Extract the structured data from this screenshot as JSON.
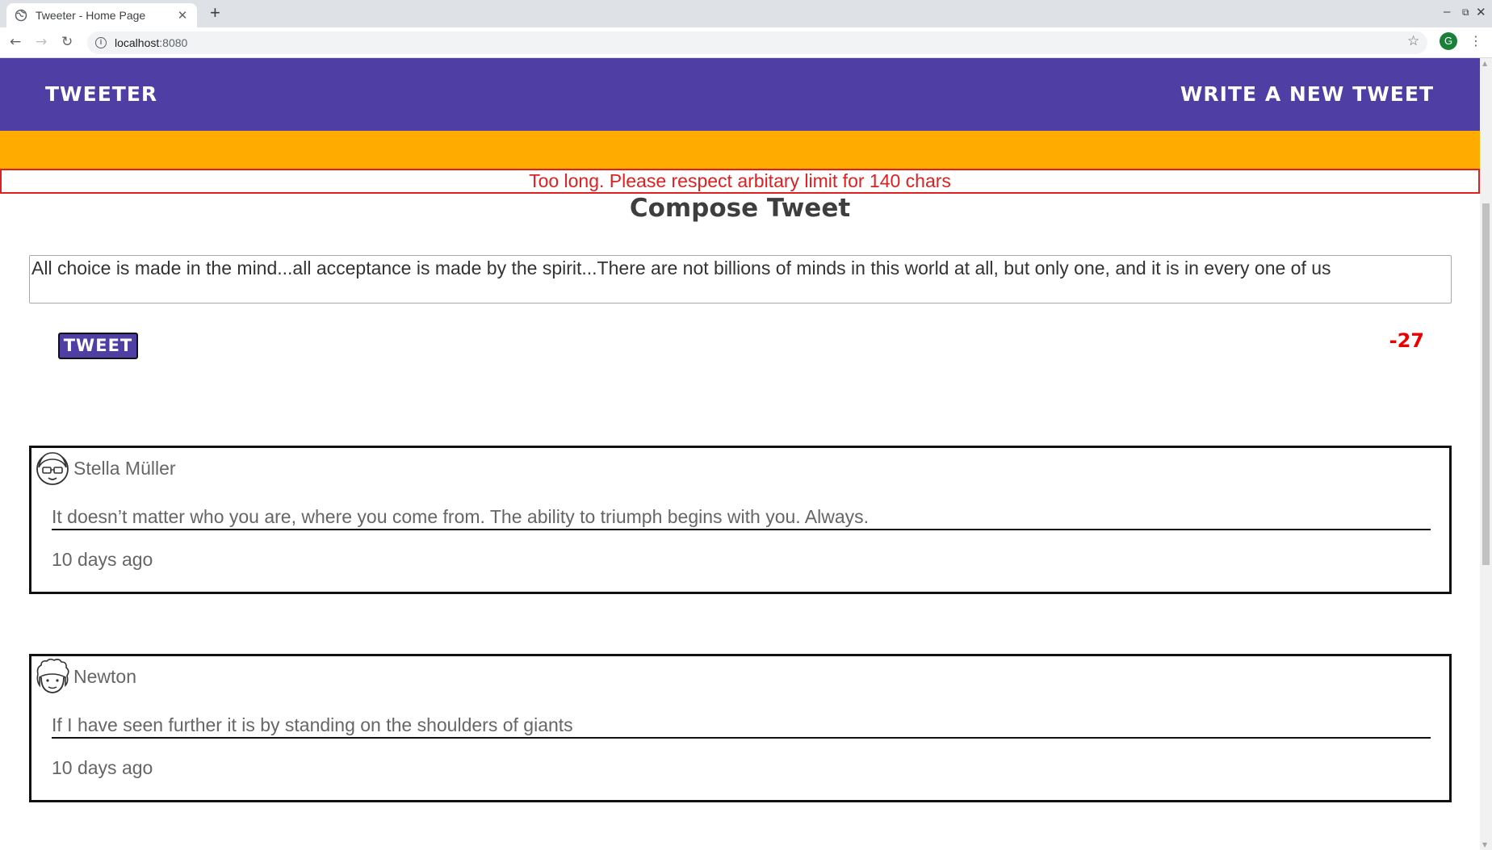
{
  "browser": {
    "tab_title": "Tweeter - Home Page",
    "tab_close": "✕",
    "new_tab": "+",
    "url_host": "localhost",
    "url_port": ":8080",
    "profile_initial": "G",
    "window_controls": [
      "–",
      "⧉",
      "✕"
    ]
  },
  "navbar": {
    "brand": "Tweeter",
    "write_link": "Write a new tweet"
  },
  "error_message": "Too long. Please respect arbitary limit for 140 chars",
  "compose": {
    "title": "Compose Tweet",
    "text": "All choice is made in the mind...all acceptance is made by the spirit...There are not billions of minds in this world at all, but only one, and it is in every one of us",
    "button_label": "Tweet",
    "counter": "-27"
  },
  "tweets": [
    {
      "name": "Stella Müller",
      "content": "It doesn’t matter who you are, where you come from. The ability to triumph begins with you. Always.",
      "time": "10 days ago",
      "avatar_icon": "glasses-face-avatar-icon"
    },
    {
      "name": "Newton",
      "content": "If I have seen further it is by standing on the shoulders of giants",
      "time": "10 days ago",
      "avatar_icon": "curly-hair-face-avatar-icon"
    }
  ],
  "colors": {
    "navbar": "#4f3ea4",
    "band": "#ffab00",
    "error": "#e02020",
    "counter": "#ee0000"
  }
}
